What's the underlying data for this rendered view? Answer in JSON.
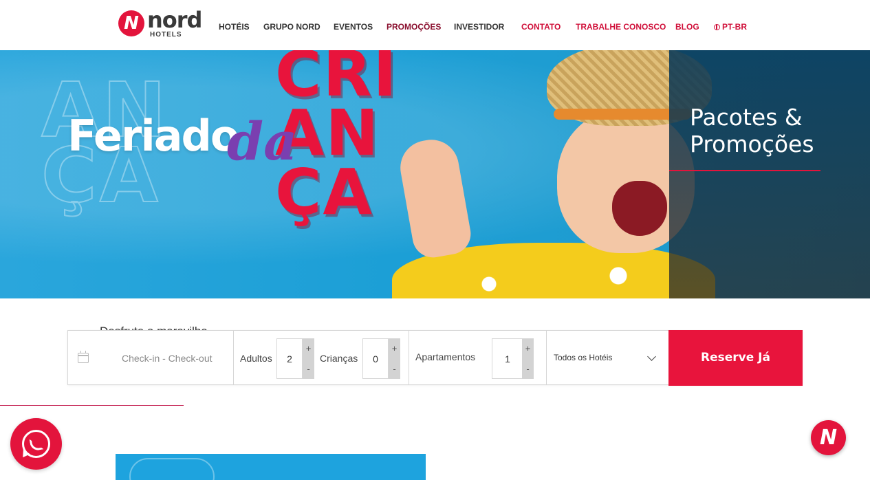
{
  "brand": {
    "logo_letter": "N",
    "name": "nord",
    "sub": "HOTELS",
    "color": "#e3143c"
  },
  "nav": {
    "items": [
      {
        "label": "HOTÉIS"
      },
      {
        "label": "GRUPO NORD"
      },
      {
        "label": "EVENTOS"
      },
      {
        "label": "PROMOÇÕES"
      },
      {
        "label": "INVESTIDOR"
      },
      {
        "label": "CONTATO"
      },
      {
        "label": "TRABALHE CONOSCO"
      },
      {
        "label": "BLOG"
      },
      {
        "label": "PT-BR",
        "icon": "globe-icon"
      }
    ]
  },
  "hero": {
    "banner_line1": "Feriado",
    "banner_line2": "da",
    "banner_line3": "CRI",
    "banner_line4": "AN",
    "banner_line5": "ÇA",
    "ghost": "AN\nÇA",
    "panel_title": "Pacotes & Promoções",
    "accent": "#e3143c"
  },
  "booking": {
    "intro": "Desfrute a maravilha...",
    "dates_placeholder": "Check-in - Check-out",
    "adults_label": "Adultos",
    "adults_value": "2",
    "children_label": "Crianças",
    "children_value": "0",
    "rooms_label": "Apartamentos",
    "rooms_value": "1",
    "plus": "+",
    "minus": "-",
    "hotel_select": "Todos os Hotéis",
    "submit": "Reserve Já"
  },
  "widgets": {
    "whatsapp_icon": "whatsapp-icon",
    "chat_letter": "N"
  }
}
